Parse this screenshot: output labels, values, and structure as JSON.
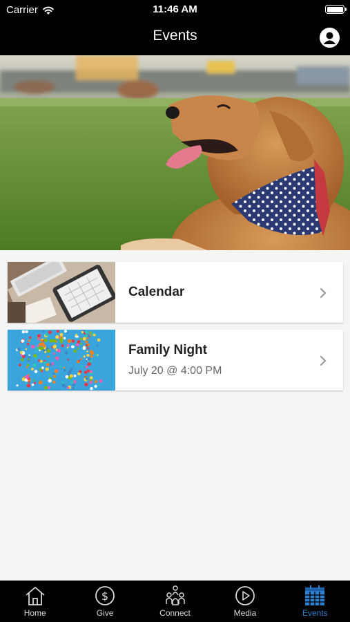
{
  "status_bar": {
    "carrier": "Carrier",
    "time": "11:46 AM"
  },
  "nav": {
    "title": "Events",
    "profile_icon": "person-circle-icon"
  },
  "events": [
    {
      "title": "Calendar",
      "subtitle": "",
      "thumb": "tablet-keyboard-photo"
    },
    {
      "title": "Family Night",
      "subtitle": "July 20 @ 4:00 PM",
      "thumb": "confetti-photo"
    }
  ],
  "tabs": [
    {
      "label": "Home",
      "icon": "home-icon",
      "active": false
    },
    {
      "label": "Give",
      "icon": "dollar-circle-icon",
      "active": false
    },
    {
      "label": "Connect",
      "icon": "people-icon",
      "active": false
    },
    {
      "label": "Media",
      "icon": "play-circle-icon",
      "active": false
    },
    {
      "label": "Events",
      "icon": "calendar-icon",
      "active": true
    }
  ],
  "colors": {
    "bar_background": "#000000",
    "active_tab": "#2f7fd0",
    "page_background": "#f5f5f5"
  }
}
